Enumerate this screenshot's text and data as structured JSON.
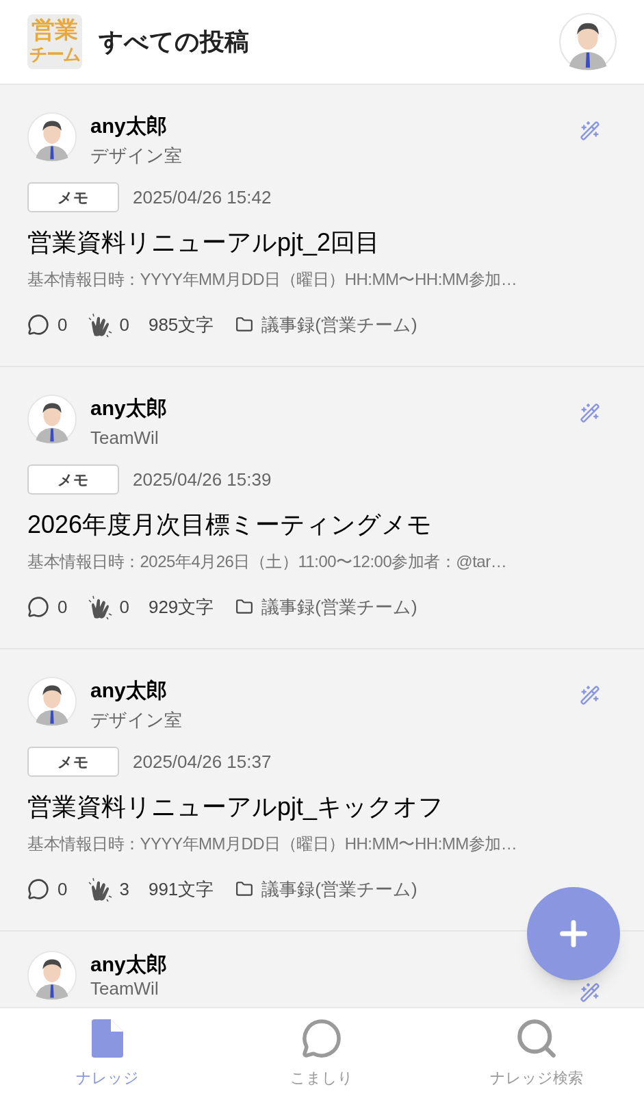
{
  "header": {
    "logo_lines": [
      "営業",
      "チーム"
    ],
    "title": "すべての投稿"
  },
  "posts": [
    {
      "author": "any太郎",
      "team": "デザイン室",
      "tag": "メモ",
      "date": "2025/04/26 15:42",
      "title": "営業資料リニューアルpjt_2回目",
      "preview": "基本情報日時：YYYY年MM月DD日（曜日）HH:MM〜HH:MM参加…",
      "comments": "0",
      "claps": "0",
      "chars": "985文字",
      "folder": "議事録(営業チーム)"
    },
    {
      "author": "any太郎",
      "team": "TeamWil",
      "tag": "メモ",
      "date": "2025/04/26 15:39",
      "title": "2026年度月次目標ミーティングメモ",
      "preview": "基本情報日時：2025年4月26日（土）11:00〜12:00参加者：@tar…",
      "comments": "0",
      "claps": "0",
      "chars": "929文字",
      "folder": "議事録(営業チーム)"
    },
    {
      "author": "any太郎",
      "team": "デザイン室",
      "tag": "メモ",
      "date": "2025/04/26 15:37",
      "title": "営業資料リニューアルpjt_キックオフ",
      "preview": "基本情報日時：YYYY年MM月DD日（曜日）HH:MM〜HH:MM参加…",
      "comments": "0",
      "claps": "3",
      "chars": "991文字",
      "folder": "議事録(営業チーム)"
    },
    {
      "author": "any太郎",
      "team": "TeamWil"
    }
  ],
  "nav": [
    {
      "label": "ナレッジ",
      "kind": "doc",
      "selected": true
    },
    {
      "label": "こましり",
      "kind": "chat",
      "selected": false
    },
    {
      "label": "ナレッジ検索",
      "kind": "search",
      "selected": false
    }
  ]
}
